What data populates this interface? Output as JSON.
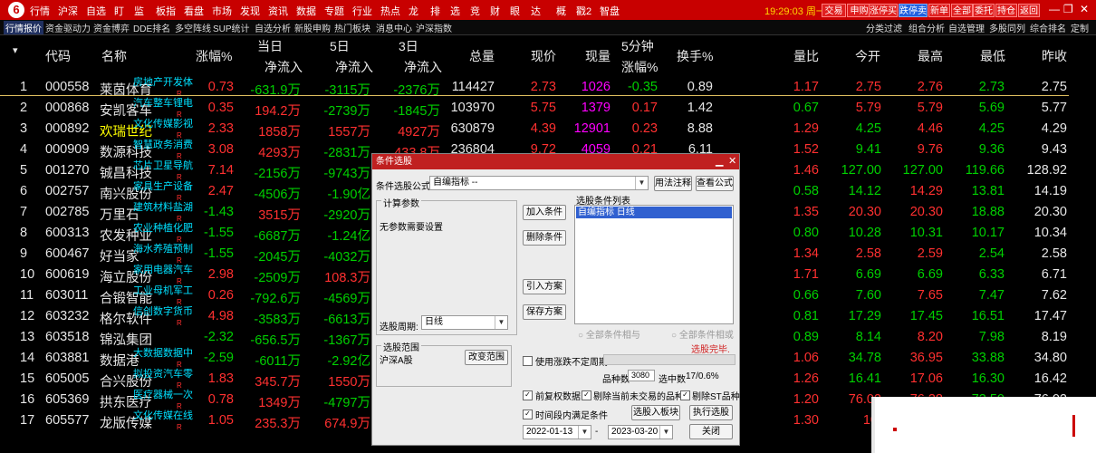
{
  "menubar": {
    "items": [
      "行情",
      "沪深",
      "自选",
      "盯",
      "监",
      "板指",
      "看盘",
      "市场",
      "发现",
      "资讯",
      "数据",
      "专题",
      "行业",
      "热点",
      "龙",
      "排",
      "选",
      "竞",
      "财",
      "眼",
      "达",
      "概",
      "戳2",
      "智盘"
    ],
    "clock": "19:29:03 周一",
    "buttons": [
      "交易",
      "申购",
      "涨停买",
      "跌停卖",
      "新单",
      "全部",
      "委托",
      "持仓",
      "返回"
    ],
    "win_controls": [
      "—",
      "❐",
      "✕"
    ]
  },
  "tabs": [
    "行情报价",
    "资金驱动力",
    "资金博弈",
    "DDE排名",
    "多空阵线",
    "SUP统计",
    "自选分析",
    "新股申购",
    "热门板块",
    "消息中心",
    "沪深指数"
  ],
  "tabs_right": [
    "分类过滤",
    "组合分析",
    "自选管理",
    "多股同列",
    "综合排名",
    "定制"
  ],
  "table": {
    "headers": {
      "sort": "▾",
      "code": "代码",
      "name": "名称",
      "pct": "涨幅%",
      "today": "当日",
      "today_sub": "净流入",
      "d5": "5日",
      "d5_sub": "净流入",
      "d3": "3日",
      "d3_sub": "净流入",
      "vol": "总量",
      "price": "现价",
      "cur": "现量",
      "m5": "5分钟",
      "m5_sub": "涨幅%",
      "turnover": "换手%",
      "vr": "量比",
      "open": "今开",
      "high": "最高",
      "low": "最低",
      "prev": "昨收"
    },
    "rows": [
      {
        "n": "1",
        "code": "000558",
        "name": "莱茵体育",
        "tag": "房地产开发体",
        "pct": "0.73",
        "today": "-631.9万",
        "d5": "-3115万",
        "d3": "-2376万",
        "vol": "114427",
        "price": "2.73",
        "cur": "1026",
        "m5": "-0.35",
        "turnover": "0.89",
        "vr": "1.17",
        "open": "2.75",
        "high": "2.76",
        "low": "2.73",
        "prev": "2.75"
      },
      {
        "n": "2",
        "code": "000868",
        "name": "安凯客车",
        "tag": "汽车整车锂电",
        "pct": "0.35",
        "today": "194.2万",
        "d5": "-2739万",
        "d3": "-1845万",
        "vol": "103970",
        "price": "5.75",
        "cur": "1379",
        "m5": "0.17",
        "turnover": "1.42",
        "vr": "0.67",
        "open": "5.79",
        "high": "5.79",
        "low": "5.69",
        "prev": "5.77"
      },
      {
        "n": "3",
        "code": "000892",
        "name": "欢瑞世纪",
        "tag": "文化传媒影视",
        "pct": "2.33",
        "today": "1858万",
        "d5": "1557万",
        "d3": "4927万",
        "vol": "630879",
        "price": "4.39",
        "cur": "12901",
        "m5": "0.23",
        "turnover": "8.88",
        "vr": "1.29",
        "open": "4.25",
        "high": "4.46",
        "low": "4.25",
        "prev": "4.29"
      },
      {
        "n": "4",
        "code": "000909",
        "name": "数源科技",
        "tag": "智慧政务消费",
        "pct": "3.08",
        "today": "4293万",
        "d5": "-2831万",
        "d3": "433.8万",
        "vol": "236804",
        "price": "9.72",
        "cur": "4059",
        "m5": "0.21",
        "turnover": "6.11",
        "vr": "1.52",
        "open": "9.41",
        "high": "9.76",
        "low": "9.36",
        "prev": "9.43"
      },
      {
        "n": "5",
        "code": "001270",
        "name": "铖昌科技",
        "tag": "芯片卫星导航",
        "pct": "7.14",
        "today": "-2156万",
        "d5": "-9743万",
        "d3": "",
        "vol": "",
        "price": "",
        "cur": "",
        "m5": "",
        "turnover": "",
        "vr": "1.46",
        "open": "127.00",
        "high": "127.00",
        "low": "119.66",
        "prev": "128.92"
      },
      {
        "n": "6",
        "code": "002757",
        "name": "南兴股份",
        "tag": "家具生产设备",
        "pct": "2.47",
        "today": "-4506万",
        "d5": "-1.90亿",
        "d3": "",
        "vol": "",
        "price": "",
        "cur": "",
        "m5": "",
        "turnover": "",
        "vr": "0.58",
        "open": "14.12",
        "high": "14.29",
        "low": "13.81",
        "prev": "14.19"
      },
      {
        "n": "7",
        "code": "002785",
        "name": "万里石",
        "tag": "建筑材料盐湖",
        "pct": "-1.43",
        "today": "3515万",
        "d5": "-2920万",
        "d3": "",
        "vol": "",
        "price": "",
        "cur": "",
        "m5": "",
        "turnover": "",
        "vr": "1.35",
        "open": "20.30",
        "high": "20.30",
        "low": "18.88",
        "prev": "20.30"
      },
      {
        "n": "8",
        "code": "600313",
        "name": "农发种业",
        "tag": "农业种植化肥",
        "pct": "-1.55",
        "today": "-6687万",
        "d5": "-1.24亿",
        "d3": "",
        "vol": "",
        "price": "",
        "cur": "",
        "m5": "",
        "turnover": "",
        "vr": "0.80",
        "open": "10.28",
        "high": "10.31",
        "low": "10.17",
        "prev": "10.34"
      },
      {
        "n": "9",
        "code": "600467",
        "name": "好当家",
        "tag": "海水养殖预制",
        "pct": "-1.55",
        "today": "-2045万",
        "d5": "-4032万",
        "d3": "",
        "vol": "",
        "price": "",
        "cur": "",
        "m5": "",
        "turnover": "",
        "vr": "1.34",
        "open": "2.58",
        "high": "2.59",
        "low": "2.54",
        "prev": "2.58"
      },
      {
        "n": "10",
        "code": "600619",
        "name": "海立股份",
        "tag": "家用电器汽车",
        "pct": "2.98",
        "today": "-2509万",
        "d5": "108.3万",
        "d3": "",
        "vol": "",
        "price": "",
        "cur": "",
        "m5": "",
        "turnover": "",
        "vr": "1.71",
        "open": "6.69",
        "high": "6.69",
        "low": "6.33",
        "prev": "6.71"
      },
      {
        "n": "11",
        "code": "603011",
        "name": "合锻智能",
        "tag": "工业母机军工",
        "pct": "0.26",
        "today": "-792.6万",
        "d5": "-4569万",
        "d3": "",
        "vol": "",
        "price": "",
        "cur": "",
        "m5": "",
        "turnover": "",
        "vr": "0.66",
        "open": "7.60",
        "high": "7.65",
        "low": "7.47",
        "prev": "7.62"
      },
      {
        "n": "12",
        "code": "603232",
        "name": "格尔软件",
        "tag": "信创数字货币",
        "pct": "4.98",
        "today": "-3583万",
        "d5": "-6613万",
        "d3": "",
        "vol": "",
        "price": "",
        "cur": "",
        "m5": "",
        "turnover": "",
        "vr": "0.81",
        "open": "17.29",
        "high": "17.45",
        "low": "16.51",
        "prev": "17.47"
      },
      {
        "n": "13",
        "code": "603518",
        "name": "锦泓集团",
        "tag": "",
        "pct": "-2.32",
        "today": "-656.5万",
        "d5": "-1367万",
        "d3": "",
        "vol": "",
        "price": "",
        "cur": "",
        "m5": "",
        "turnover": "",
        "vr": "0.89",
        "open": "8.14",
        "high": "8.20",
        "low": "7.98",
        "prev": "8.19"
      },
      {
        "n": "14",
        "code": "603881",
        "name": "数据港",
        "tag": "大数据数据中",
        "pct": "-2.59",
        "today": "-6011万",
        "d5": "-2.92亿",
        "d3": "",
        "vol": "",
        "price": "",
        "cur": "",
        "m5": "",
        "turnover": "",
        "vr": "1.06",
        "open": "34.78",
        "high": "36.95",
        "low": "33.88",
        "prev": "34.80"
      },
      {
        "n": "15",
        "code": "605005",
        "name": "合兴股份",
        "tag": "拟投资汽车零",
        "pct": "1.83",
        "today": "345.7万",
        "d5": "1550万",
        "d3": "",
        "vol": "",
        "price": "",
        "cur": "",
        "m5": "",
        "turnover": "",
        "vr": "1.26",
        "open": "16.41",
        "high": "17.06",
        "low": "16.30",
        "prev": "16.42"
      },
      {
        "n": "16",
        "code": "605369",
        "name": "拱东医疗",
        "tag": "医疗器械一次",
        "pct": "0.78",
        "today": "1349万",
        "d5": "-4797万",
        "d3": "",
        "vol": "",
        "price": "",
        "cur": "",
        "m5": "",
        "turnover": "",
        "vr": "1.20",
        "open": "76.02",
        "high": "76.38",
        "low": "73.50",
        "prev": "76.02"
      },
      {
        "n": "17",
        "code": "605577",
        "name": "龙版传媒",
        "tag": "文化传媒在线",
        "pct": "1.05",
        "today": "235.3万",
        "d5": "674.9万",
        "d3": "",
        "vol": "",
        "price": "",
        "cur": "",
        "m5": "",
        "turnover": "",
        "vr": "1.30",
        "open": "10.",
        "high": "",
        "low": "",
        "prev": ""
      }
    ]
  },
  "dialog": {
    "title": "条件选股",
    "formula_label": "条件选股公式",
    "formula_value": "自编指标      --",
    "btn_help": "用法注释",
    "btn_view": "查看公式",
    "calc_params": "计算参数",
    "no_params": "无参数需要设置",
    "btn_add": "加入条件",
    "btn_delete": "删除条件",
    "btn_import": "引入方案",
    "btn_save": "保存方案",
    "list_title": "选股条件列表",
    "list_item": "自编指标  日线",
    "period_label": "选股周期:",
    "period_value": "日线",
    "radio_all_and": "全部条件相与",
    "radio_all_or": "全部条件相或",
    "done_text": "选股完毕.",
    "range_title": "选股范围",
    "range_value": "沪深A股",
    "btn_change_range": "改变范围",
    "chk_variable_period": "使用涨跌不定周期",
    "count_label": "品种数",
    "count_value": "3080",
    "selected_label": "选中数",
    "selected_value": "17/0.6%",
    "chk_pre_adjust": "前复权数据",
    "chk_exclude_nontrade": "剔除当前未交易的品种",
    "chk_exclude_st": "剔除ST品种",
    "chk_time_range": "时间段内满足条件",
    "btn_to_block": "选股入板块",
    "btn_run": "执行选股",
    "date_from": "2022-01-13",
    "date_sep": "-",
    "date_to": "2023-03-20",
    "btn_close": "关闭"
  }
}
